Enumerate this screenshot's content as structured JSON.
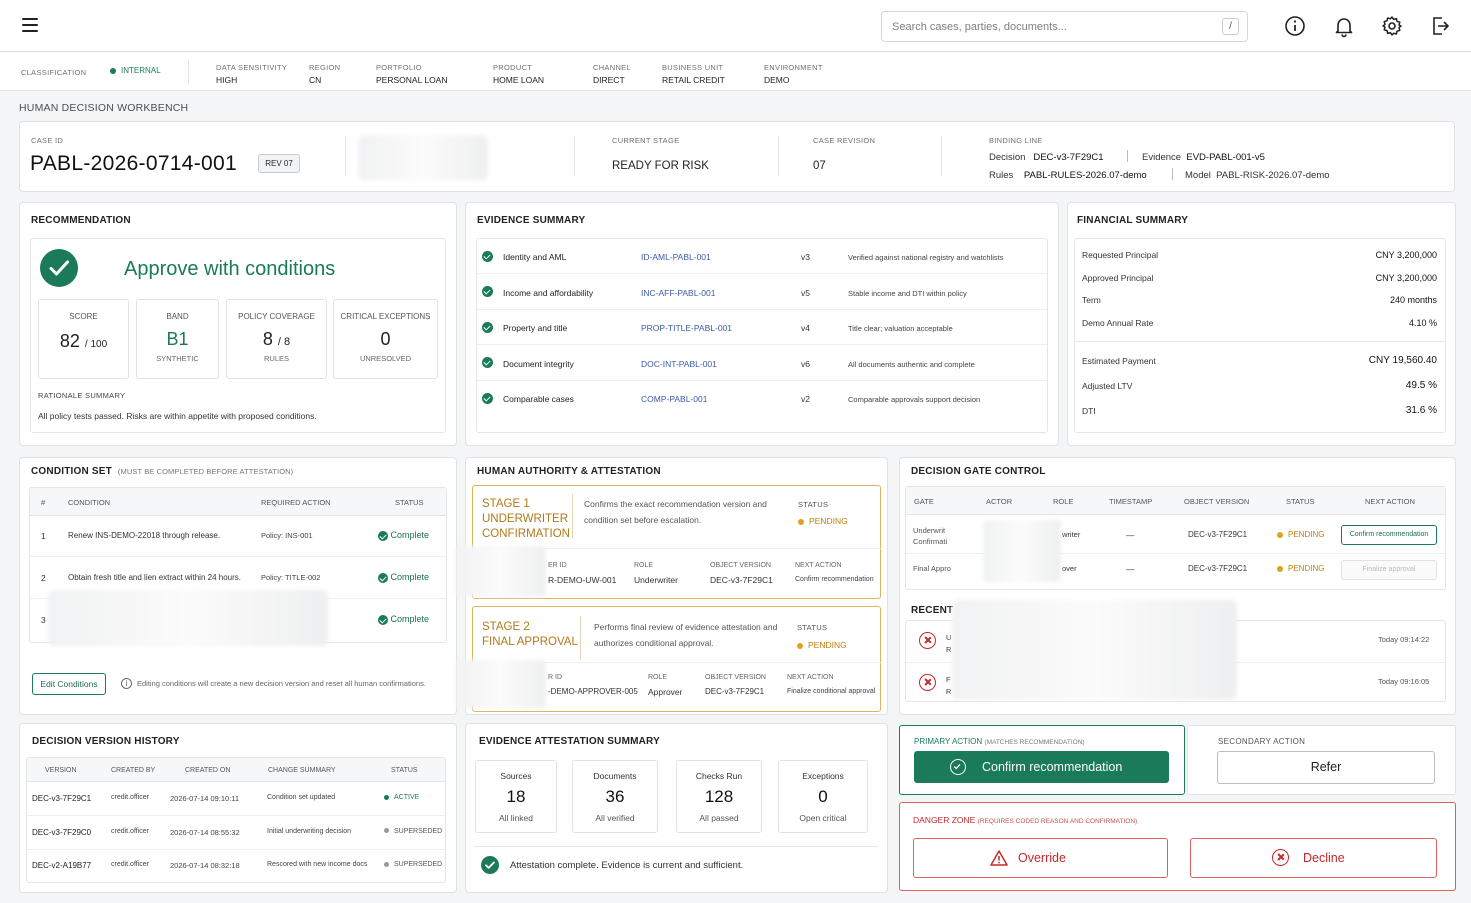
{
  "header": {
    "search_placeholder": "Search cases, parties, documents...",
    "search_shortcut": "/"
  },
  "meta": {
    "classification_label": "CLASSIFICATION",
    "classification_value": "INTERNAL",
    "fields": [
      {
        "label": "DATA SENSITIVITY",
        "value": "HIGH"
      },
      {
        "label": "REGION",
        "value": "CN"
      },
      {
        "label": "PORTFOLIO",
        "value": "PERSONAL LOAN"
      },
      {
        "label": "PRODUCT",
        "value": "HOME LOAN"
      },
      {
        "label": "CHANNEL",
        "value": "DIRECT"
      },
      {
        "label": "BUSINESS UNIT",
        "value": "RETAIL CREDIT"
      },
      {
        "label": "ENVIRONMENT",
        "value": "DEMO"
      }
    ]
  },
  "page_title": "HUMAN DECISION WORKBENCH",
  "case": {
    "id_label": "CASE ID",
    "id": "PABL-2026-0714-001",
    "rev_badge": "REV 07",
    "stage_label": "CURRENT STAGE",
    "stage": "READY FOR RISK",
    "revision_label": "CASE REVISION",
    "revision": "07",
    "binding_label": "BINDING LINE",
    "decision_label": "Decision",
    "decision": "DEC-v3-7F29C1",
    "evidence_label": "Evidence",
    "evidence": "EVD-PABL-001-v5",
    "rules_label": "Rules",
    "rules": "PABL-RULES-2026.07-demo",
    "model_label": "Model",
    "model": "PABL-RISK-2026.07-demo"
  },
  "recommendation": {
    "title": "RECOMMENDATION",
    "headline": "Approve with conditions",
    "kpis": [
      {
        "label": "SCORE",
        "value": "82",
        "suffix": "/ 100",
        "sub": ""
      },
      {
        "label": "BAND",
        "value": "B1",
        "suffix": "",
        "sub": "SYNTHETIC"
      },
      {
        "label": "POLICY COVERAGE",
        "value": "8",
        "suffix": "/ 8",
        "sub": "RULES"
      },
      {
        "label": "CRITICAL EXCEPTIONS",
        "value": "0",
        "suffix": "",
        "sub": "UNRESOLVED"
      }
    ],
    "rationale_label": "RATIONALE SUMMARY",
    "rationale": "All policy tests passed. Risks are within appetite with proposed conditions."
  },
  "evidence_summary": {
    "title": "EVIDENCE SUMMARY",
    "rows": [
      {
        "name": "Identity and AML",
        "ref": "ID-AML-PABL-001",
        "ver": "v3",
        "note": "Verified against national registry and watchlists"
      },
      {
        "name": "Income and affordability",
        "ref": "INC-AFF-PABL-001",
        "ver": "v5",
        "note": "Stable income and DTI within policy"
      },
      {
        "name": "Property and title",
        "ref": "PROP-TITLE-PABL-001",
        "ver": "v4",
        "note": "Title clear; valuation acceptable"
      },
      {
        "name": "Document integrity",
        "ref": "DOC-INT-PABL-001",
        "ver": "v6",
        "note": "All documents authentic and complete"
      },
      {
        "name": "Comparable cases",
        "ref": "COMP-PABL-001",
        "ver": "v2",
        "note": "Comparable approvals support decision"
      }
    ]
  },
  "financial": {
    "title": "FINANCIAL SUMMARY",
    "group1": [
      {
        "label": "Requested Principal",
        "value": "CNY 3,200,000"
      },
      {
        "label": "Approved Principal",
        "value": "CNY 3,200,000"
      },
      {
        "label": "Term",
        "value": "240 months"
      },
      {
        "label": "Demo Annual Rate",
        "value": "4.10 %"
      }
    ],
    "group2": [
      {
        "label": "Estimated Payment",
        "value": "CNY 19,560.40"
      },
      {
        "label": "Adjusted LTV",
        "value": "49.5 %"
      },
      {
        "label": "DTI",
        "value": "31.6 %"
      }
    ]
  },
  "conditions": {
    "title": "CONDITION SET",
    "subtitle": "(MUST BE COMPLETED BEFORE ATTESTATION)",
    "headers": [
      "#",
      "CONDITION",
      "REQUIRED ACTION",
      "STATUS"
    ],
    "rows": [
      {
        "num": "1",
        "condition": "Renew INS-DEMO-22018 through release.",
        "action": "Policy: INS-001",
        "status": "Complete"
      },
      {
        "num": "2",
        "condition": "Obtain fresh title and lien extract within 24 hours.",
        "action": "Policy: TITLE-002",
        "status": "Complete"
      },
      {
        "num": "3",
        "condition": "",
        "action": "",
        "status": "Complete"
      }
    ],
    "edit_label": "Edit Conditions",
    "edit_note": "Editing conditions will create a new decision version and reset all human confirmations."
  },
  "authority": {
    "title": "HUMAN AUTHORITY & ATTESTATION",
    "status_label": "STATUS",
    "stages": [
      {
        "title1": "STAGE 1",
        "title2": "UNDERWRITER",
        "title3": "CONFIRMATION",
        "desc": "Confirms the exact recommendation version and condition set before escalation.",
        "status": "PENDING",
        "id_label": "ER ID",
        "id": "R-DEMO-UW-001",
        "role_label": "ROLE",
        "role": "Underwriter",
        "obj_label": "OBJECT VERSION",
        "obj": "DEC-v3-7F29C1",
        "next_label": "NEXT ACTION",
        "next": "Confirm recommendation"
      },
      {
        "title1": "STAGE 2",
        "title2": "FINAL APPROVAL",
        "title3": "",
        "desc": "Performs final review of evidence attestation and authorizes conditional approval.",
        "status": "PENDING",
        "id_label": "R ID",
        "id": "-DEMO-APPROVER-005",
        "role_label": "ROLE",
        "role": "Approver",
        "obj_label": "OBJECT VERSION",
        "obj": "DEC-v3-7F29C1",
        "next_label": "NEXT ACTION",
        "next": "Finalize conditional approval"
      }
    ]
  },
  "gate": {
    "title": "DECISION GATE CONTROL",
    "headers": [
      "GATE",
      "ACTOR",
      "ROLE",
      "TIMESTAMP",
      "OBJECT VERSION",
      "STATUS",
      "NEXT ACTION"
    ],
    "rows": [
      {
        "gate1": "Underwrit",
        "gate2": "Confirmati",
        "role": "writer",
        "ts": "—",
        "obj": "DEC-v3-7F29C1",
        "status": "PENDING",
        "action": "Confirm recommendation"
      },
      {
        "gate1": "Final Appro",
        "gate2": "",
        "role": "over",
        "ts": "—",
        "obj": "DEC-v3-7F29C1",
        "status": "PENDING",
        "action": "Finalize approval"
      }
    ],
    "recent_label": "RECENT (",
    "recent": [
      {
        "a": "U",
        "b": "R",
        "time": "Today 09:14:22"
      },
      {
        "a": "F",
        "b": "R",
        "time": "Today 09:16:05"
      }
    ]
  },
  "versions": {
    "title": "DECISION VERSION HISTORY",
    "headers": [
      "VERSION",
      "CREATED BY",
      "CREATED ON",
      "CHANGE SUMMARY",
      "STATUS"
    ],
    "rows": [
      {
        "ver": "DEC-v3-7F29C1",
        "by": "credit.officer",
        "on": "2026-07-14 09:10:11",
        "summary": "Condition set updated",
        "status": "ACTIVE"
      },
      {
        "ver": "DEC-v3-7F29C0",
        "by": "credit.officer",
        "on": "2026-07-14 08:55:32",
        "summary": "Initial underwriting decision",
        "status": "SUPERSEDED"
      },
      {
        "ver": "DEC-v2-A19B77",
        "by": "credit.officer",
        "on": "2026-07-14 08:32:18",
        "summary": "Rescored with new income docs",
        "status": "SUPERSEDED"
      }
    ]
  },
  "attestation": {
    "title": "EVIDENCE ATTESTATION SUMMARY",
    "stats": [
      {
        "label": "Sources",
        "value": "18",
        "sub": "All linked"
      },
      {
        "label": "Documents",
        "value": "36",
        "sub": "All verified"
      },
      {
        "label": "Checks Run",
        "value": "128",
        "sub": "All passed"
      },
      {
        "label": "Exceptions",
        "value": "0",
        "sub": "Open critical"
      }
    ],
    "footer": "Attestation complete. Evidence is current and sufficient."
  },
  "actions": {
    "primary_label": "PRIMARY ACTION",
    "primary_sub": "(MATCHES RECOMMENDATION)",
    "primary_button": "Confirm recommendation",
    "secondary_label": "SECONDARY ACTION",
    "secondary_button": "Refer",
    "danger_label": "DANGER ZONE",
    "danger_sub": "(REQUIRES CODED REASON AND CONFIRMATION)",
    "override_button": "Override",
    "decline_button": "Decline"
  }
}
